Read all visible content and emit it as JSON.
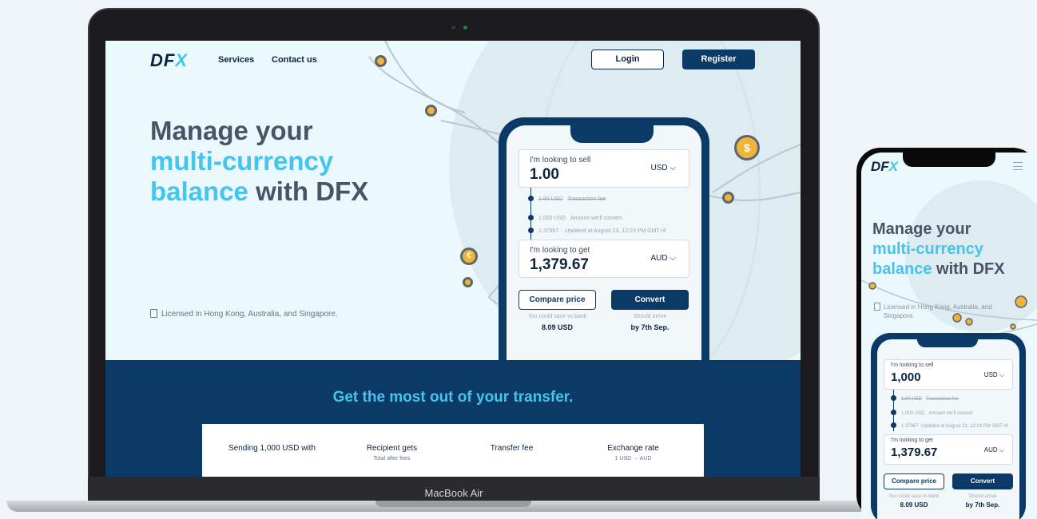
{
  "site": {
    "logo": "DF",
    "logo_x": "X",
    "nav": [
      "Services",
      "Contact us"
    ],
    "login_label": "Login",
    "register_label": "Register",
    "headline": {
      "line1": "Manage your",
      "line2": "multi-currency",
      "line3_blue": "balance",
      "line3_rest": " with DFX"
    },
    "licensed": "Licensed in Hong Kong, Australia, and Singapore."
  },
  "converter": {
    "sell_label": "I'm looking to sell",
    "sell_value": "1.00",
    "sell_currency": "USD",
    "fee_amount": "1.60 USD",
    "fee_label": "Transaction fee",
    "convert_amount": "1,000 USD",
    "convert_label": "Amount we'll convert",
    "rate_value": "1.37967",
    "rate_label": "Updated at August 23, 12:23 PM GMT+8",
    "get_label": "I'm looking to get",
    "get_value": "1,379.67",
    "get_currency": "AUD",
    "compare_label": "Compare price",
    "convert_btn": "Convert",
    "save_label": "You could save vs bank",
    "save_value": "8.09 USD",
    "arrive_label": "Should arrive",
    "arrive_value": "by 7th Sep."
  },
  "mobile": {
    "sell_value": "1,000",
    "licensed_line1": "Licensed in Hong Kong, Australia, and",
    "licensed_line2": "Singapore."
  },
  "transfer": {
    "title": "Get the most out of your transfer.",
    "columns": [
      {
        "label": "Sending 1,000 USD with",
        "sub": ""
      },
      {
        "label": "Recipient gets",
        "sub": "Total after fees"
      },
      {
        "label": "Transfer fee",
        "sub": ""
      },
      {
        "label": "Exchange rate",
        "sub": "1 USD → AUD"
      }
    ]
  },
  "device": {
    "mac_label": "MacBook Air"
  },
  "icons": {
    "coin_dollar": "$",
    "coin_euro": "€",
    "chevron": "chevron-down-icon",
    "menu": "hamburger-menu-icon",
    "document": "document-icon"
  },
  "colors": {
    "navy": "#0b3a66",
    "cyan": "#45c4ef",
    "gold": "#f0b43a",
    "slate": "#4a5468"
  }
}
